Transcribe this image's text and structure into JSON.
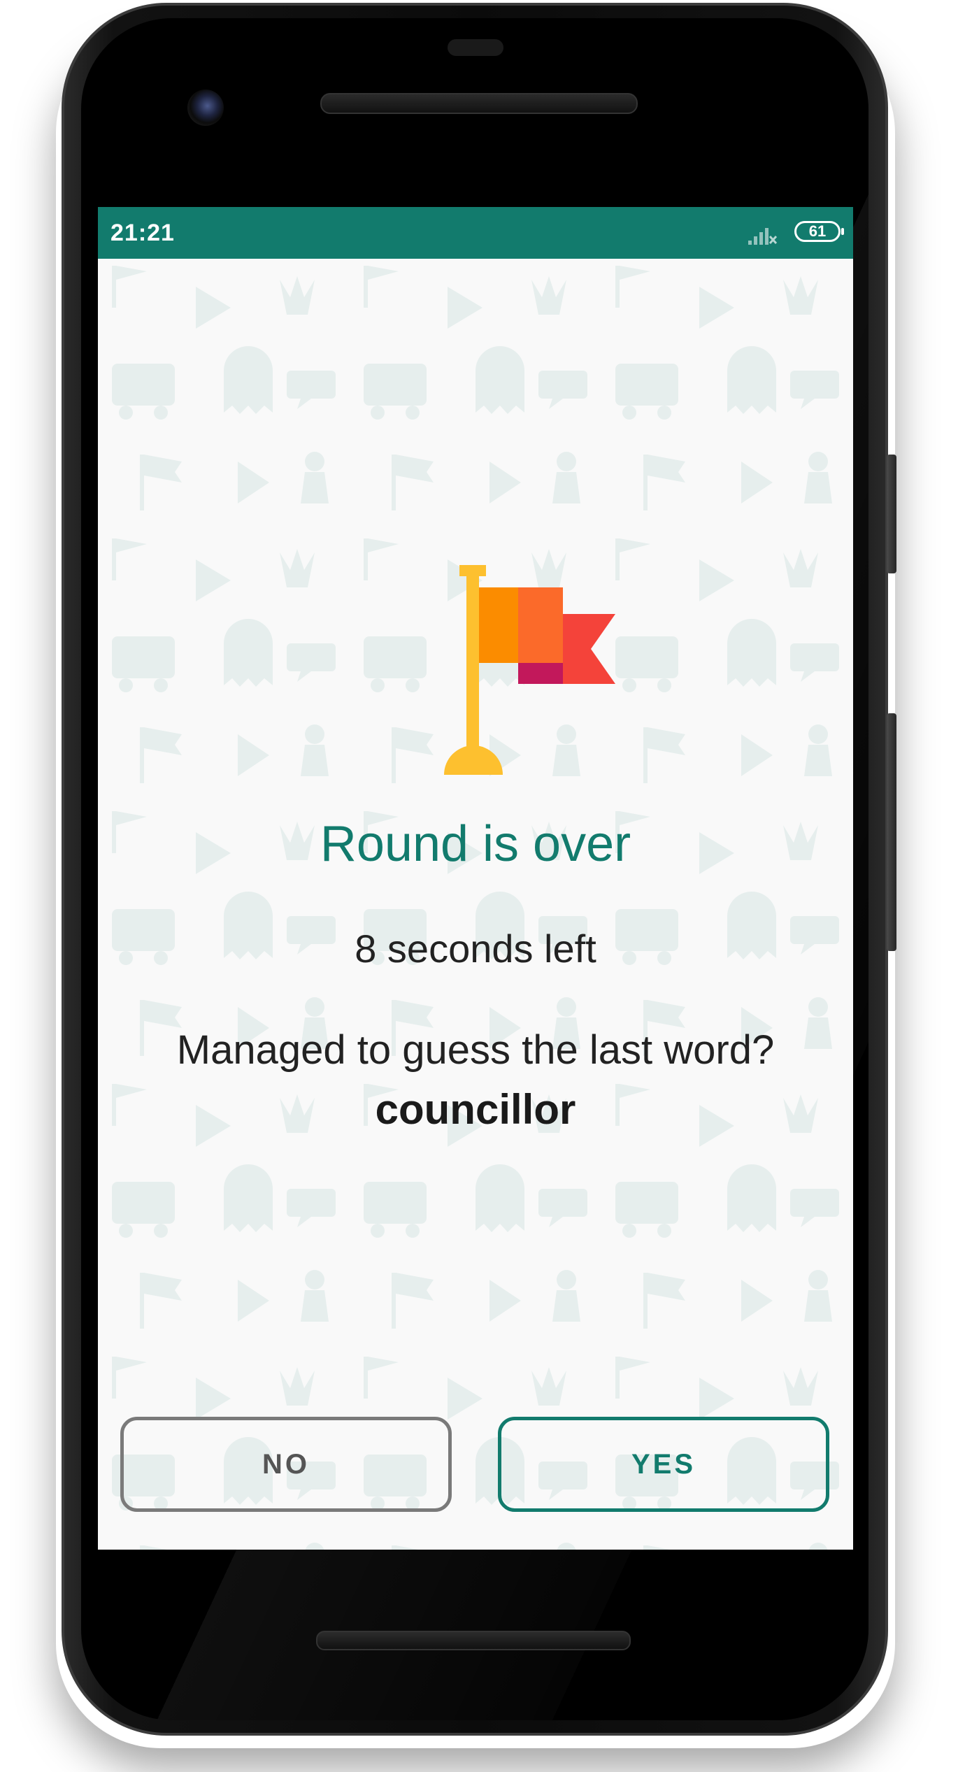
{
  "status_bar": {
    "time": "21:21",
    "battery": "61",
    "signal_icon": "signal-off-icon",
    "color": "#127b6d"
  },
  "flag_icon": "flag-icon",
  "result": {
    "title": "Round is over",
    "seconds_left": "8 seconds left",
    "question": "Managed to guess the last word?",
    "word": "councillor"
  },
  "buttons": {
    "no_label": "NO",
    "yes_label": "YES"
  },
  "colors": {
    "accent": "#127b6d",
    "screen_bg": "#f9f9f9",
    "flag_pole": "#fdc02f",
    "flag_orange": "#fb8c00",
    "flag_red": "#f4433a",
    "flag_dark": "#c2185b"
  }
}
